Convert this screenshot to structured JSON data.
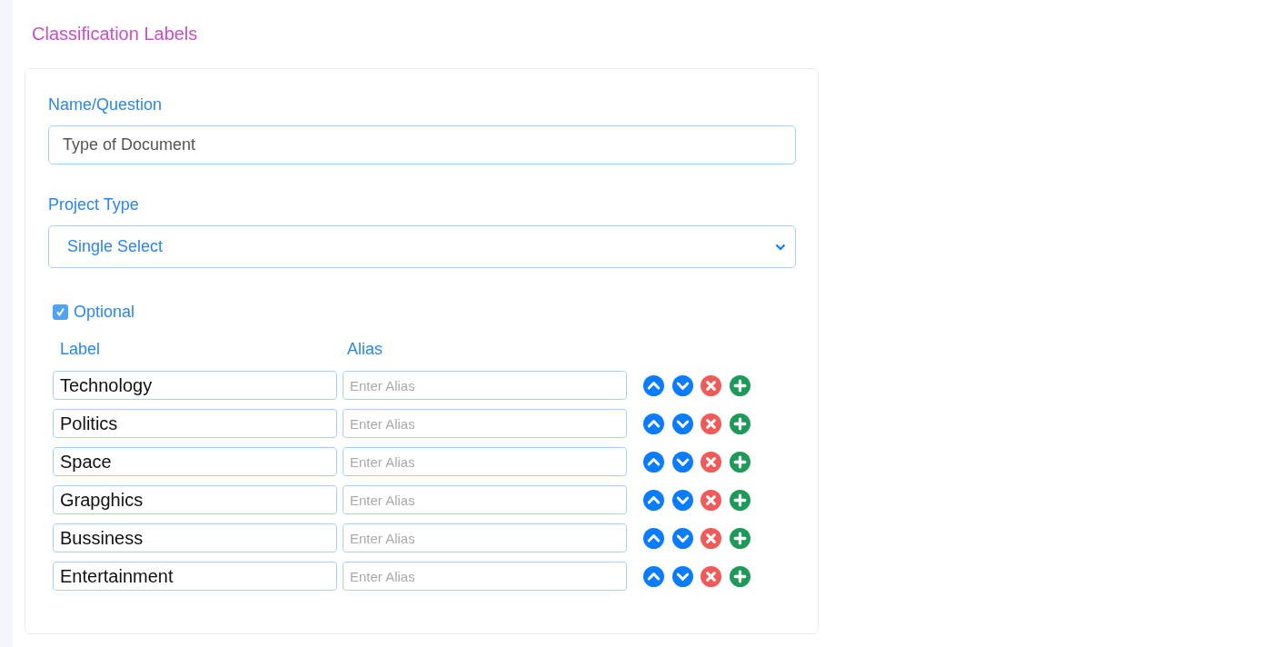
{
  "title": "Classification Labels",
  "name_field": {
    "label": "Name/Question",
    "value": "Type of Document"
  },
  "project_type": {
    "label": "Project Type",
    "value": "Single Select"
  },
  "optional": {
    "label": "Optional",
    "checked": true
  },
  "columns": [
    "Label",
    "Alias"
  ],
  "rows": [
    {
      "label": "Technology",
      "alias_placeholder": "Enter Alias"
    },
    {
      "label": "Politics",
      "alias_placeholder": "Enter Alias"
    },
    {
      "label": "Space",
      "alias_placeholder": "Enter Alias"
    },
    {
      "label": "Grapghics",
      "alias_placeholder": "Enter Alias"
    },
    {
      "label": "Bussiness",
      "alias_placeholder": "Enter Alias"
    },
    {
      "label": "Entertainment",
      "alias_placeholder": "Enter Alias"
    }
  ]
}
